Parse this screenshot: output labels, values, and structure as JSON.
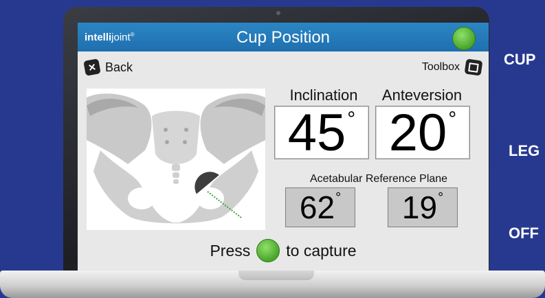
{
  "app": {
    "brand_bold": "intelli",
    "brand_rest": "joint",
    "brand_mark": "®",
    "title": "Cup Position"
  },
  "nav": {
    "back_label": "Back",
    "toolbox_label": "Toolbox"
  },
  "measurements": {
    "inclination_label": "Inclination",
    "inclination_value": "45",
    "anteversion_label": "Anteversion",
    "anteversion_value": "20",
    "degree_symbol": "°",
    "reference_plane_label": "Acetabular Reference Plane",
    "reference_inclination": "62",
    "reference_anteversion": "19"
  },
  "capture": {
    "prefix": "Press",
    "suffix": "to capture"
  },
  "side_labels": [
    "CUP",
    "LEG",
    "OFF"
  ],
  "colors": {
    "background": "#27398f",
    "header": "#1f6fae",
    "status_green": "#4aa52a",
    "value_box": "#ffffff",
    "reference_box": "#c8c8c8"
  }
}
